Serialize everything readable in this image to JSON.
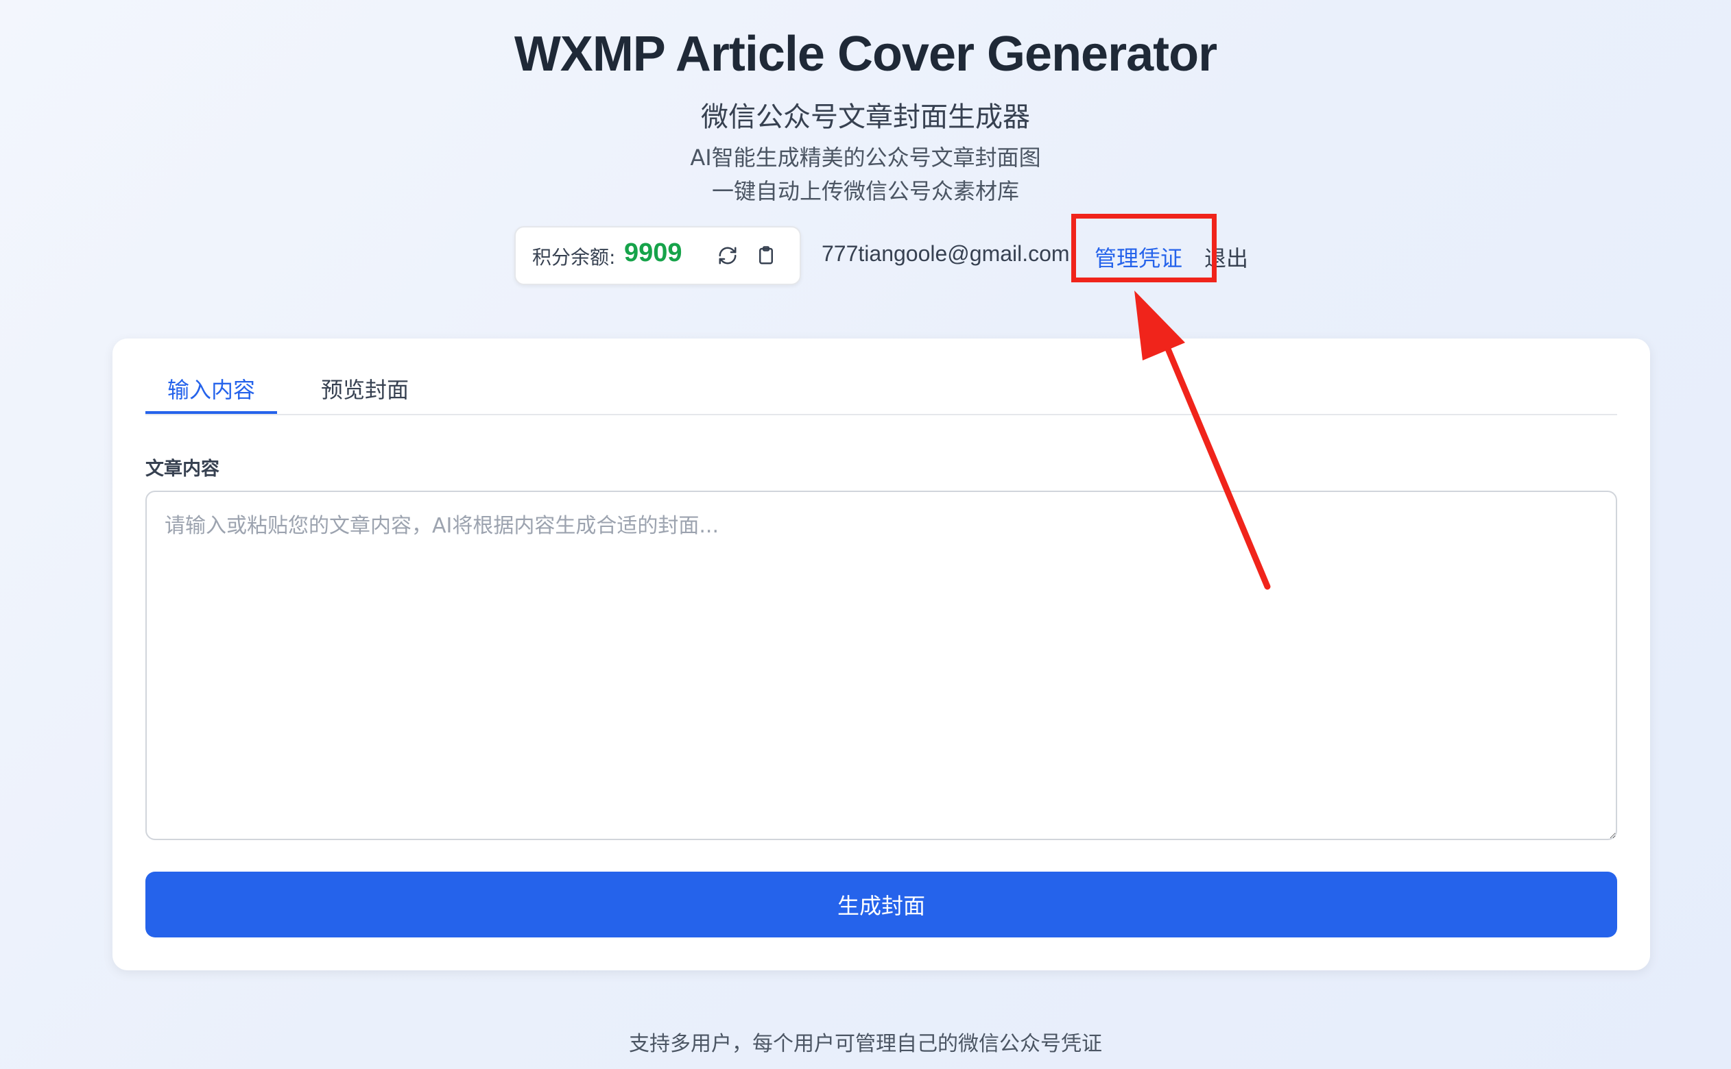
{
  "header": {
    "title": "WXMP Article Cover Generator",
    "subtitle": "微信公众号文章封面生成器",
    "description_line1": "AI智能生成精美的公众号文章封面图",
    "description_line2": "一键自动上传微信公号众素材库"
  },
  "account": {
    "points_label": "积分余额:",
    "points_value": "9909",
    "refresh_icon": "refresh-icon",
    "clipboard_icon": "clipboard-icon",
    "email": "777tiangoole@gmail.com",
    "manage_credentials": "管理凭证",
    "logout": "退出"
  },
  "tabs": [
    {
      "label": "输入内容",
      "active": true
    },
    {
      "label": "预览封面",
      "active": false
    }
  ],
  "form": {
    "article_label": "文章内容",
    "article_placeholder": "请输入或粘贴您的文章内容，AI将根据内容生成合适的封面...",
    "article_value": "",
    "generate_label": "生成封面"
  },
  "footer": {
    "text": "支持多用户，每个用户可管理自己的微信公众号凭证"
  },
  "colors": {
    "accent": "#2563eb",
    "points": "#16a34a",
    "annotation": "#f0241b"
  }
}
